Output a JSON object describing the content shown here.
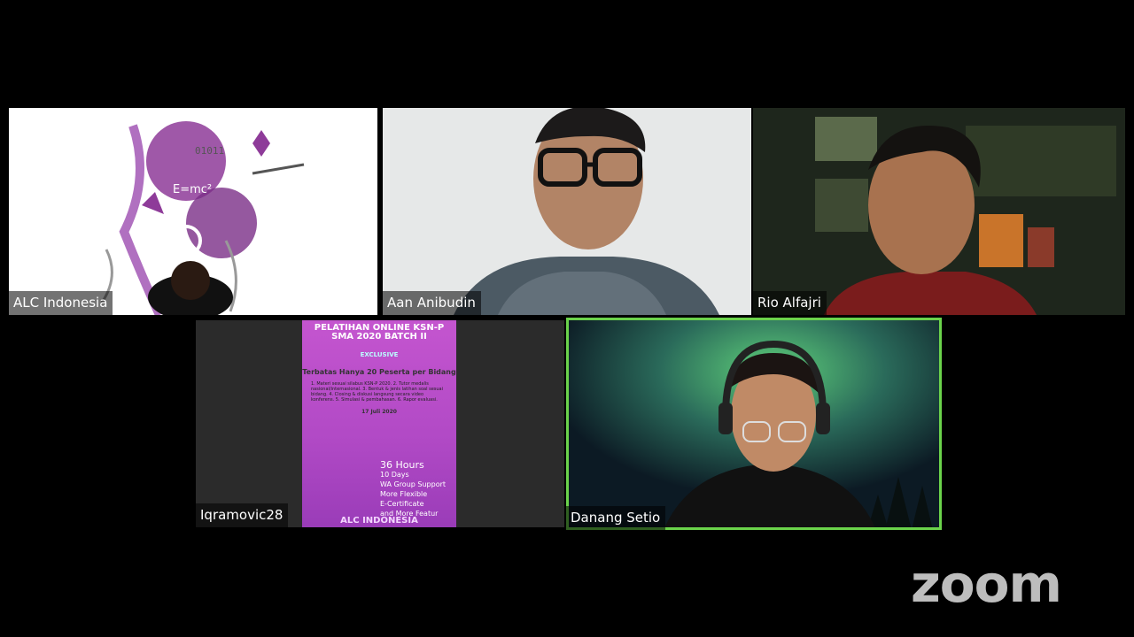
{
  "participants": [
    {
      "name": "ALC Indonesia"
    },
    {
      "name": "Aan Anibudin"
    },
    {
      "name": "Rio Alfajri"
    },
    {
      "name": "Iqramovic28"
    },
    {
      "name": "Danang Setio"
    }
  ],
  "poster": {
    "title": "PELATIHAN ONLINE KSN-P SMA 2020 BATCH II",
    "exclusive": "EXCLUSIVE",
    "headline": "Terbatas Hanya 20 Peserta per Bidang",
    "date": "17 Juli 2020",
    "hours": "36 Hours",
    "days": "10 Days",
    "wa": "WA Group Support",
    "flex": "More Flexible",
    "cert": "E-Certificate",
    "more": "and More Featur",
    "footer": "ALC INDONESIA"
  },
  "branding": {
    "logo": "zoom"
  },
  "colors": {
    "active_speaker": "#6bd34b",
    "background": "#000000"
  }
}
